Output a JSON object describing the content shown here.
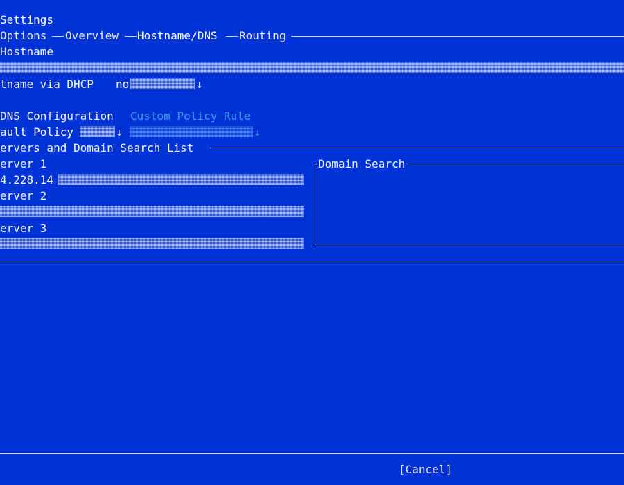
{
  "window": {
    "title": "Settings"
  },
  "tabs": [
    {
      "label": "Options",
      "active": false
    },
    {
      "label": "Overview",
      "active": false
    },
    {
      "label": "Hostname/DNS",
      "active": true
    },
    {
      "label": "Routing",
      "active": false
    }
  ],
  "hostname": {
    "label": "Hostname",
    "value": ""
  },
  "dhcp_hostname": {
    "label": "tname via DHCP",
    "value": "no",
    "icon": "down-arrow"
  },
  "dns_config": {
    "label": "DNS Configuration",
    "custom_policy_label": "Custom Policy Rule",
    "default_policy_label": "ault Policy",
    "default_policy_value": "",
    "custom_policy_value": "",
    "arrow_glyph": "↓"
  },
  "servers_section": {
    "title": "ervers and Domain Search List",
    "servers": [
      {
        "label": "erver 1",
        "value": "4.228.14"
      },
      {
        "label": "erver 2",
        "value": ""
      },
      {
        "label": "erver 3",
        "value": ""
      }
    ],
    "domain_search": {
      "title": "Domain Search",
      "items": []
    }
  },
  "buttons": {
    "cancel": "[Cancel]"
  },
  "colors": {
    "background": "#0033d6",
    "text": "#f2f2f2",
    "disabled": "#3f9bf0",
    "border": "#d8d8d8"
  }
}
